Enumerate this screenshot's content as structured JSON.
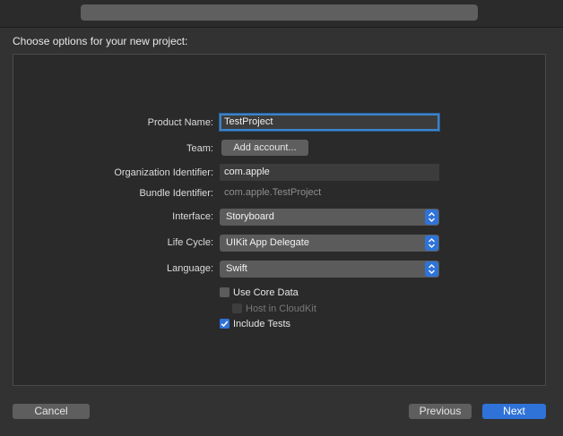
{
  "heading": "Choose options for your new project:",
  "form": {
    "product_name_label": "Product Name:",
    "product_name_value": "TestProject",
    "team_label": "Team:",
    "add_account_label": "Add account...",
    "org_id_label": "Organization Identifier:",
    "org_id_value": "com.apple",
    "bundle_id_label": "Bundle Identifier:",
    "bundle_id_value": "com.apple.TestProject",
    "interface_label": "Interface:",
    "interface_value": "Storyboard",
    "lifecycle_label": "Life Cycle:",
    "lifecycle_value": "UIKit App Delegate",
    "language_label": "Language:",
    "language_value": "Swift",
    "use_core_data_label": "Use Core Data",
    "use_core_data_checked": false,
    "host_cloudkit_label": "Host in CloudKit",
    "host_cloudkit_checked": false,
    "include_tests_label": "Include Tests",
    "include_tests_checked": true
  },
  "footer": {
    "cancel_label": "Cancel",
    "previous_label": "Previous",
    "next_label": "Next"
  },
  "colors": {
    "accent": "#2f73d8",
    "background": "#323232"
  }
}
